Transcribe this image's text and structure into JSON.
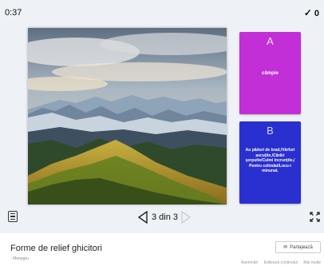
{
  "game": {
    "timer": "0:37",
    "score": "0",
    "image_alt": "mountain landscape with forest",
    "options": [
      {
        "letter": "A",
        "text": "câmpie",
        "color": "#c22fd6"
      },
      {
        "letter": "B",
        "text": "Au păduri de brad,/Vârfuri ascuțite,/Cărări șerpuite/Culmi încrunțite,/ Pentru colindat/Locu-i minunat.",
        "color": "#2a2fd0"
      }
    ]
  },
  "controls": {
    "menu_icon": "menu-icon",
    "prev_icon": "triangle-left-icon",
    "next_icon": "triangle-right-icon",
    "page_indicator": "3 din 3",
    "fullscreen_icon": "fullscreen-icon"
  },
  "info": {
    "title": "Forme de relief ghicitori",
    "share_label": "Partajează",
    "author": "Menegru",
    "links": [
      "Asemnări",
      "Editează conținutul",
      "Mai multe"
    ]
  }
}
